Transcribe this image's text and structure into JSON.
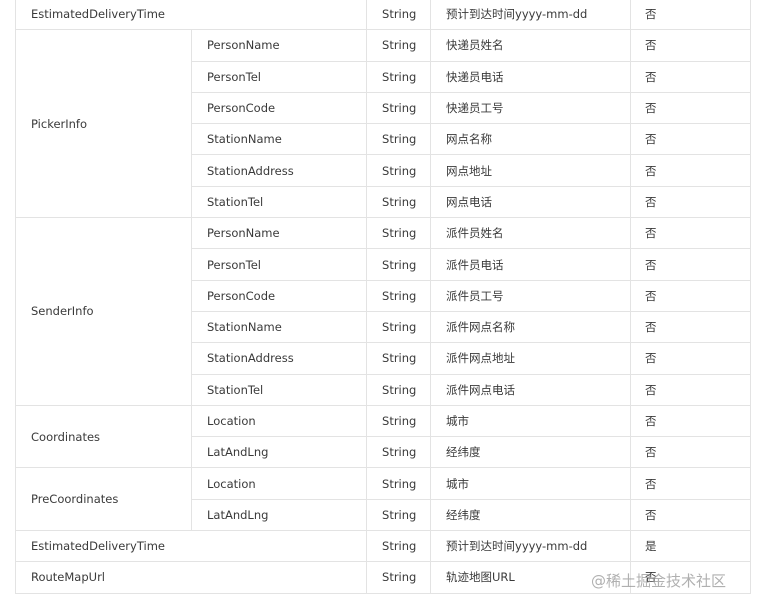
{
  "table": {
    "row_first": {
      "field": "EstimatedDeliveryTime",
      "type": "String",
      "desc": "预计到达时间yyyy-mm-dd",
      "required": "否"
    },
    "groups": [
      {
        "name": "PickerInfo",
        "rows": [
          {
            "field": "PersonName",
            "type": "String",
            "desc": "快递员姓名",
            "required": "否"
          },
          {
            "field": "PersonTel",
            "type": "String",
            "desc": "快递员电话",
            "required": "否"
          },
          {
            "field": "PersonCode",
            "type": "String",
            "desc": "快递员工号",
            "required": "否"
          },
          {
            "field": "StationName",
            "type": "String",
            "desc": "网点名称",
            "required": "否"
          },
          {
            "field": "StationAddress",
            "type": "String",
            "desc": "网点地址",
            "required": "否"
          },
          {
            "field": "StationTel",
            "type": "String",
            "desc": "网点电话",
            "required": "否"
          }
        ]
      },
      {
        "name": "SenderInfo",
        "rows": [
          {
            "field": "PersonName",
            "type": "String",
            "desc": "派件员姓名",
            "required": "否"
          },
          {
            "field": "PersonTel",
            "type": "String",
            "desc": "派件员电话",
            "required": "否"
          },
          {
            "field": "PersonCode",
            "type": "String",
            "desc": "派件员工号",
            "required": "否"
          },
          {
            "field": "StationName",
            "type": "String",
            "desc": "派件网点名称",
            "required": "否"
          },
          {
            "field": "StationAddress",
            "type": "String",
            "desc": "派件网点地址",
            "required": "否"
          },
          {
            "field": "StationTel",
            "type": "String",
            "desc": "派件网点电话",
            "required": "否"
          }
        ]
      },
      {
        "name": "Coordinates",
        "rows": [
          {
            "field": "Location",
            "type": "String",
            "desc": "城市",
            "required": "否"
          },
          {
            "field": "LatAndLng",
            "type": "String",
            "desc": "经纬度",
            "required": "否"
          }
        ]
      },
      {
        "name": "PreCoordinates",
        "rows": [
          {
            "field": "Location",
            "type": "String",
            "desc": "城市",
            "required": "否"
          },
          {
            "field": "LatAndLng",
            "type": "String",
            "desc": "经纬度",
            "required": "否"
          }
        ]
      }
    ],
    "row_est": {
      "field": "EstimatedDeliveryTime",
      "type": "String",
      "desc": "预计到达时间yyyy-mm-dd",
      "required": "是"
    },
    "row_route": {
      "field": "RouteMapUrl",
      "type": "String",
      "desc": "轨迹地图URL",
      "required": "否"
    }
  },
  "watermark": "@稀土掘金技术社区"
}
